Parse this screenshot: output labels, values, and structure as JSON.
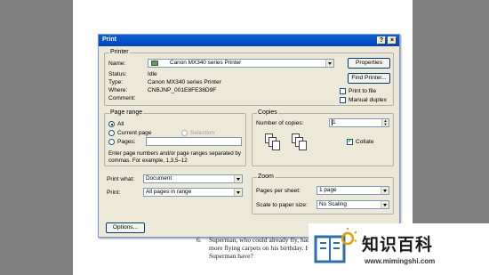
{
  "dialog": {
    "title": "Print",
    "help_label": "?",
    "close_label": "×"
  },
  "printer": {
    "legend": "Printer",
    "name_label": "Name:",
    "name_value": "Canon MX340 series Printer",
    "properties_label": "Properties",
    "find_printer_label": "Find Printer...",
    "status_label": "Status:",
    "status_value": "Idle",
    "type_label": "Type:",
    "type_value": "Canon MX340 series Printer",
    "where_label": "Where:",
    "where_value": "CNBJNP_001E8FE38D9F",
    "comment_label": "Comment:",
    "print_to_file_label": "Print to file",
    "manual_duplex_label": "Manual duplex"
  },
  "page_range": {
    "legend": "Page range",
    "all_label": "All",
    "current_page_label": "Current page",
    "selection_label": "Selection",
    "pages_label": "Pages:",
    "hint": "Enter page numbers and/or page ranges separated by commas.  For example, 1,3,5–12"
  },
  "copies": {
    "legend": "Copies",
    "number_label": "Number of copies:",
    "number_value": "1",
    "collate_label": "Collate"
  },
  "print_what": {
    "label": "Print what:",
    "value": "Document"
  },
  "print_option": {
    "label": "Print:",
    "value": "All pages in range"
  },
  "zoom": {
    "legend": "Zoom",
    "pages_per_sheet_label": "Pages per sheet:",
    "pages_per_sheet_value": "1 page",
    "scale_label": "Scale to paper size:",
    "scale_value": "No Scaling"
  },
  "options_label": "Options...",
  "document": {
    "item_number": "6.",
    "line1": "Superman, who could already fly, had 2 flying carpets.",
    "line2": "more flying carpets on his birthday. How many unnece",
    "line3": "Superman have?"
  },
  "watermark": {
    "title": "知识百科",
    "url": "www.mimingshi.com"
  }
}
